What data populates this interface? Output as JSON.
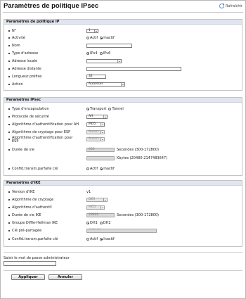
{
  "header": {
    "title": "Paramètres de politique IPsec",
    "refresh_label": "Rafraîchir"
  },
  "ip_policy": {
    "heading": "Paramètres de politique IP",
    "number": {
      "label": "N°",
      "value": "1"
    },
    "activity": {
      "label": "Activité",
      "option_active": "Actif",
      "option_inactive": "Inactif"
    },
    "name": {
      "label": "Nom",
      "value": ""
    },
    "address_type": {
      "label": "Type d'adresse",
      "option_ipv4": "IPv4",
      "option_ipv6": "IPv6"
    },
    "local_address": {
      "label": "Adresse locale",
      "value": ""
    },
    "remote_address": {
      "label": "Adresse distante",
      "value": ""
    },
    "prefix_length": {
      "label": "Longueur préfixe",
      "value": "32"
    },
    "action": {
      "label": "Action",
      "value": "Autoriser"
    }
  },
  "ipsec": {
    "heading": "Paramètres IPsec",
    "encapsulation": {
      "label": "Type d'encapsulation",
      "option_transport": "Transport",
      "option_tunnel": "Tunnel"
    },
    "security_protocol": {
      "label": "Protocole de sécurité",
      "value": "AH"
    },
    "ah_auth": {
      "label": "Algorithme d'authentification pour AH",
      "value": "MD5"
    },
    "esp_crypto": {
      "label": "Algorithme de cryptage pour ESP",
      "value": "Aucun"
    },
    "esp_auth": {
      "label": "Algorithme d'authentification pour ESP",
      "value": "Aucun"
    },
    "lifetime": {
      "label": "Durée de vie",
      "seconds_value": "600",
      "seconds_unit": "Secondes (300-172800)",
      "kbytes_value": "",
      "kbytes_unit": "Kbytes (20480-2147483647)"
    },
    "pfs": {
      "label": "Confid.transm.parfaite clé",
      "option_active": "Actif",
      "option_inactive": "Inactif"
    }
  },
  "ike": {
    "heading": "Paramètres d'IKE",
    "version": {
      "label": "Version d'IKE",
      "value": "v1"
    },
    "crypto": {
      "label": "Algorithme de cryptage",
      "value": "DES"
    },
    "auth": {
      "label": "Algorithme d'authentif.",
      "value": "MD5"
    },
    "lifetime": {
      "label": "Durée de vie IKE",
      "value": "28800",
      "unit": "Secondes (300-172800)"
    },
    "dh_group": {
      "label": "Groupe Diffie-Hellman IKE",
      "option_dh1": "DH1",
      "option_dh2": "DH2"
    },
    "psk": {
      "label": "Clé pré-partagée",
      "value": "********"
    },
    "pfs": {
      "label": "Confid.transm.parfaite clé",
      "option_active": "Actif",
      "option_inactive": "Inactif"
    }
  },
  "admin_password": {
    "label": "Saisir le mot de passe administrateur",
    "value": ""
  },
  "buttons": {
    "apply": "Appliquer",
    "cancel": "Annuler"
  }
}
